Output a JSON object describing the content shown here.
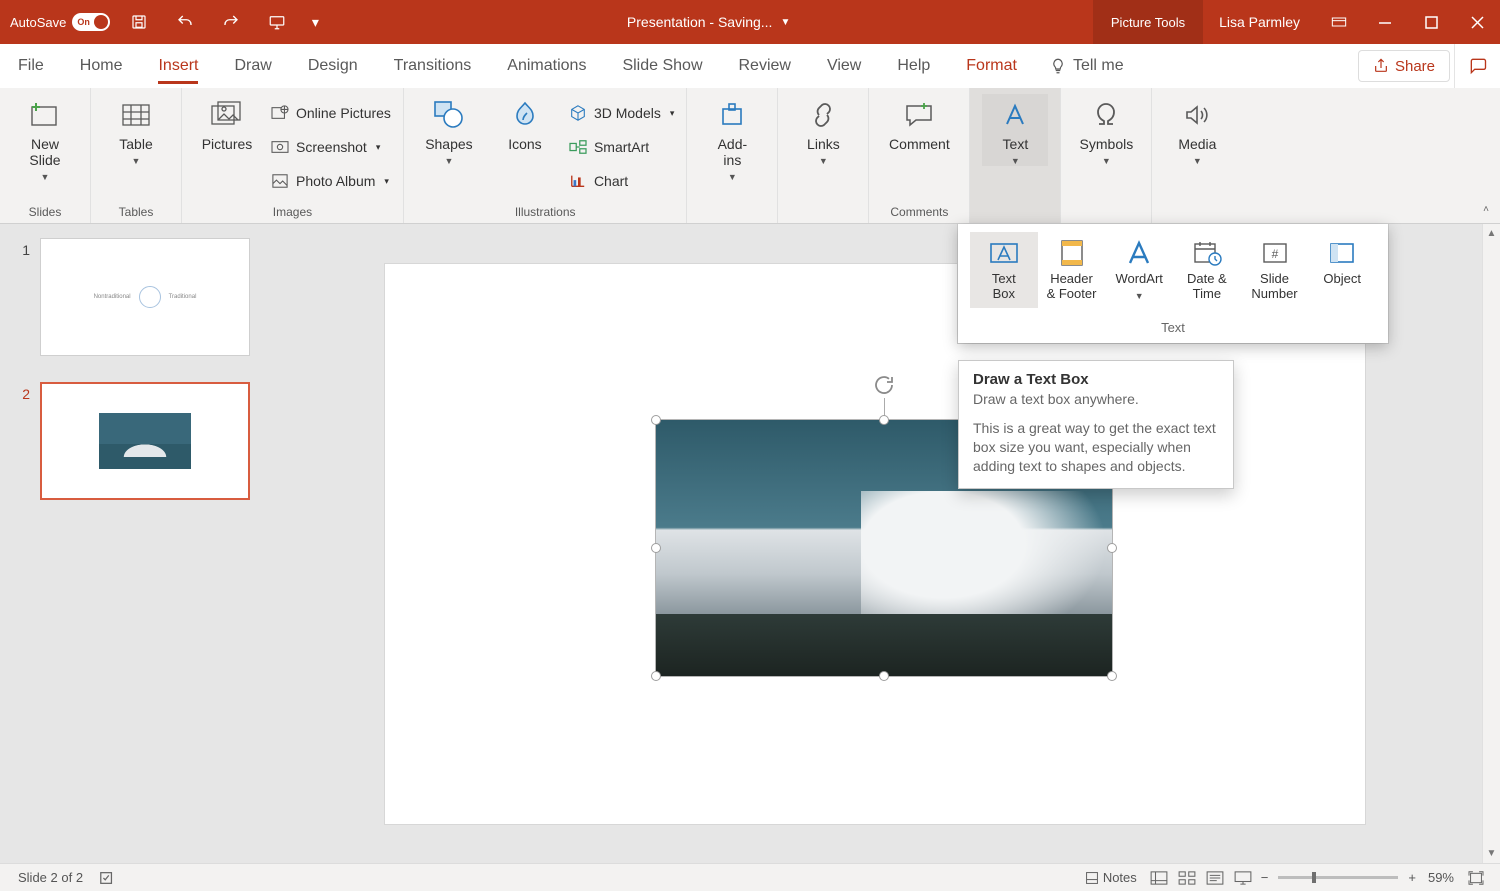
{
  "title_bar": {
    "autosave_label": "AutoSave",
    "autosave_state": "On",
    "doc_title": "Presentation  -  Saving...",
    "contextual_tab": "Picture Tools",
    "user_name": "Lisa Parmley"
  },
  "menu_tabs": {
    "items": [
      "File",
      "Home",
      "Insert",
      "Draw",
      "Design",
      "Transitions",
      "Animations",
      "Slide Show",
      "Review",
      "View",
      "Help",
      "Format"
    ],
    "active_index": 2,
    "tell_me": "Tell me",
    "share": "Share"
  },
  "ribbon": {
    "slides": {
      "new_slide": "New\nSlide",
      "group_label": "Slides"
    },
    "tables": {
      "table": "Table",
      "group_label": "Tables"
    },
    "images": {
      "pictures": "Pictures",
      "online_pictures": "Online Pictures",
      "screenshot": "Screenshot",
      "photo_album": "Photo Album",
      "group_label": "Images"
    },
    "illustrations": {
      "shapes": "Shapes",
      "icons": "Icons",
      "models": "3D Models",
      "smartart": "SmartArt",
      "chart": "Chart",
      "group_label": "Illustrations"
    },
    "addins": {
      "addins": "Add-\nins"
    },
    "links": {
      "links": "Links"
    },
    "comments": {
      "comment": "Comment",
      "group_label": "Comments"
    },
    "text": {
      "text": "Text"
    },
    "symbols": {
      "symbols": "Symbols"
    },
    "media": {
      "media": "Media"
    }
  },
  "text_dropdown": {
    "items": {
      "text_box": "Text\nBox",
      "header_footer": "Header\n& Footer",
      "wordart": "WordArt",
      "date_time": "Date &\nTime",
      "slide_number": "Slide\nNumber",
      "object": "Object"
    },
    "group_label": "Text"
  },
  "tooltip": {
    "title": "Draw a Text Box",
    "line1": "Draw a text box anywhere.",
    "line2": "This is a great way to get the exact text box size you want, especially when adding text to shapes and objects."
  },
  "thumbnails": {
    "items": [
      {
        "num": "1"
      },
      {
        "num": "2"
      }
    ],
    "selected_index": 1
  },
  "status_bar": {
    "slide_info": "Slide 2 of 2",
    "notes": "Notes",
    "zoom_percent": "59%"
  }
}
